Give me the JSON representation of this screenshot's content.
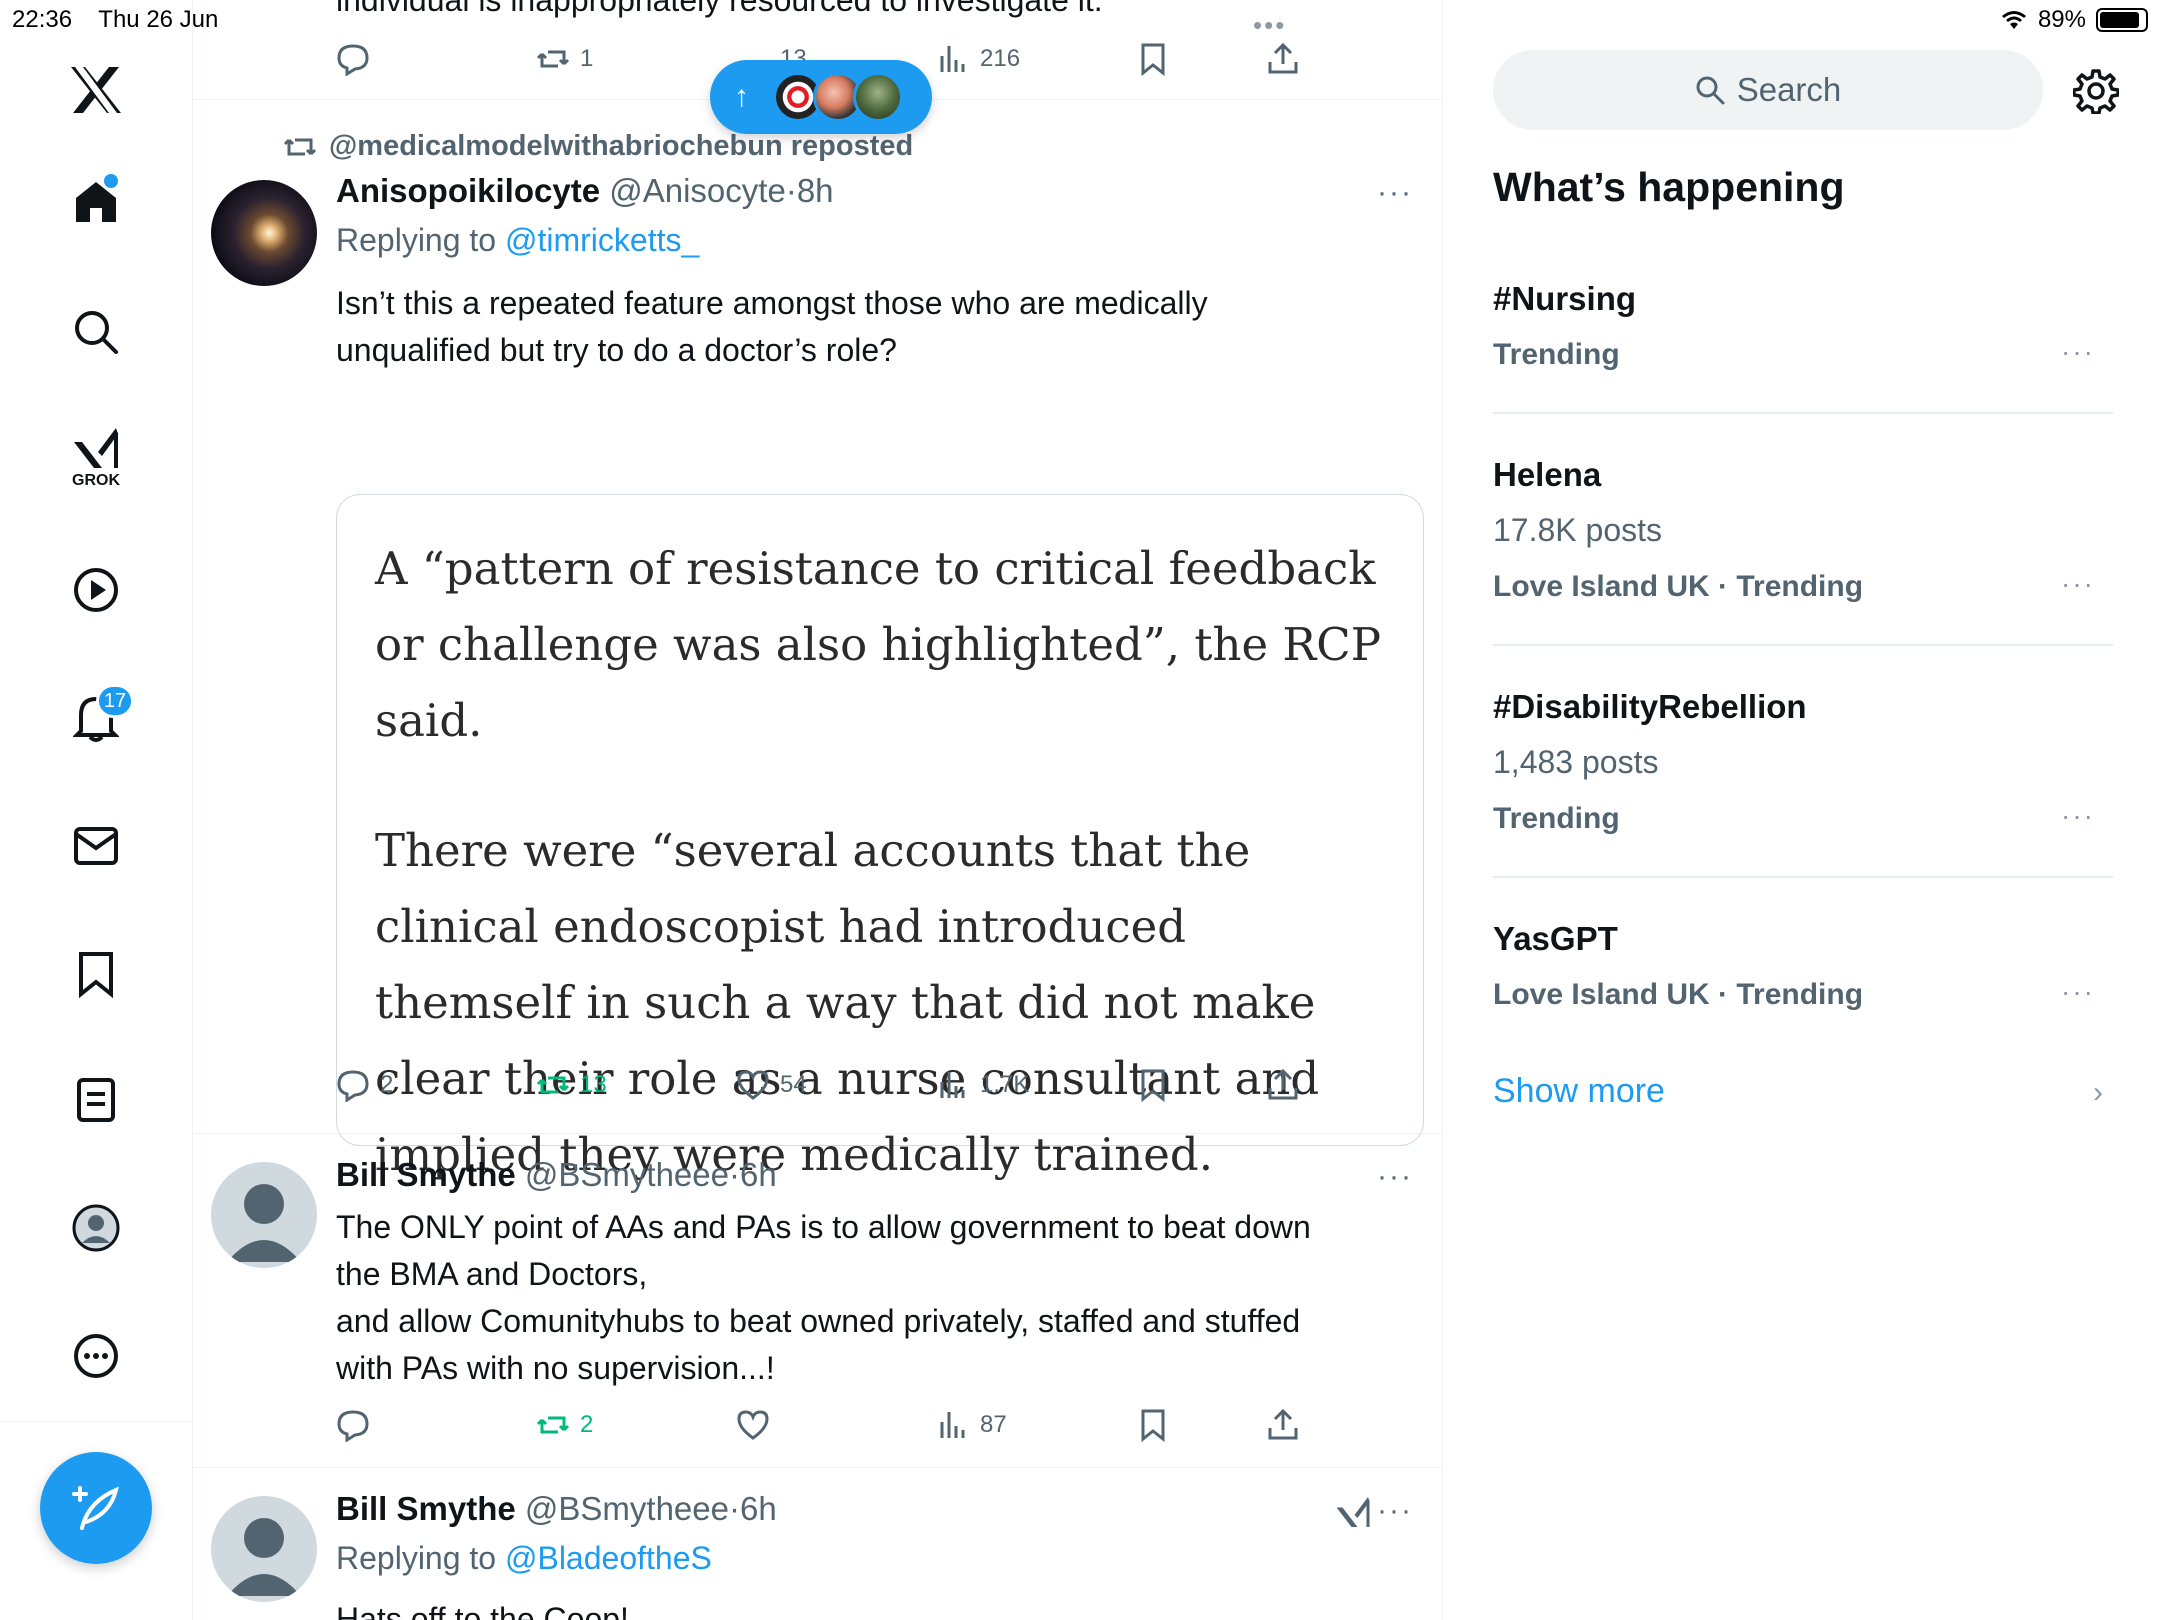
{
  "status_bar": {
    "time": "22:36",
    "date": "Thu 26 Jun",
    "battery": "89%",
    "battery_level": 0.89
  },
  "nav": {
    "grok_label": "GROK",
    "notifications_badge": "17"
  },
  "top_post": {
    "truncated_text": "individual is inappropriately resourced to investigate it.",
    "reposts": "1",
    "likes": "13",
    "views": "216"
  },
  "new_posts_pill": {
    "arrow": "↑"
  },
  "repost_post": {
    "repost_line": "@medicalmodelwithabriochebun reposted",
    "name": "Anisopoikilocyte",
    "handle": "@Anisocyte",
    "sep": "·",
    "time": "8h",
    "replying_prefix": "Replying to",
    "replying_handle": "@timricketts_",
    "text": "Isn’t this a repeated feature amongst those who are medically unqualified but try to do a doctor’s role?",
    "quote_paragraphs": [
      "A “pattern of resistance to critical feedback or challenge was also highlighted”, the RCP said.",
      "There were “several accounts that the clinical endoscopist had introduced themself in such a way that did not make clear their role as a nurse consultant and implied they were medically trained."
    ],
    "replies": "2",
    "reposts": "13",
    "likes": "54",
    "views": "1.7K"
  },
  "post_bill_1": {
    "name": "Bill Smythe",
    "handle": "@BSmytheee",
    "sep": "·",
    "time": "6h",
    "text_lines": [
      "The ONLY point of AAs  and PAs is to allow government to beat down",
      "the BMA and Doctors,",
      "and allow Comunityhubs to beat owned privately, staffed and stuffed",
      "with PAs with no supervision...!"
    ],
    "reposts": "2",
    "views": "87"
  },
  "post_bill_2": {
    "name": "Bill Smythe",
    "handle": "@BSmytheee",
    "sep": "·",
    "time": "6h",
    "replying_prefix": "Replying to",
    "replying_handle": "@BladeoftheS",
    "text": "Hats off to the Coop!"
  },
  "right_column": {
    "search_placeholder": "Search",
    "section_title": "What’s happening",
    "trends": [
      {
        "title": "#Nursing",
        "count": "",
        "context": "Trending"
      },
      {
        "title": "Helena",
        "count": "17.8K posts",
        "context": "Love Island UK · Trending"
      },
      {
        "title": "#DisabilityRebellion",
        "count": "1,483 posts",
        "context": "Trending"
      },
      {
        "title": "YasGPT",
        "count": "",
        "context": "Love Island UK · Trending"
      }
    ],
    "show_more": "Show more"
  },
  "more_glyph": "···"
}
